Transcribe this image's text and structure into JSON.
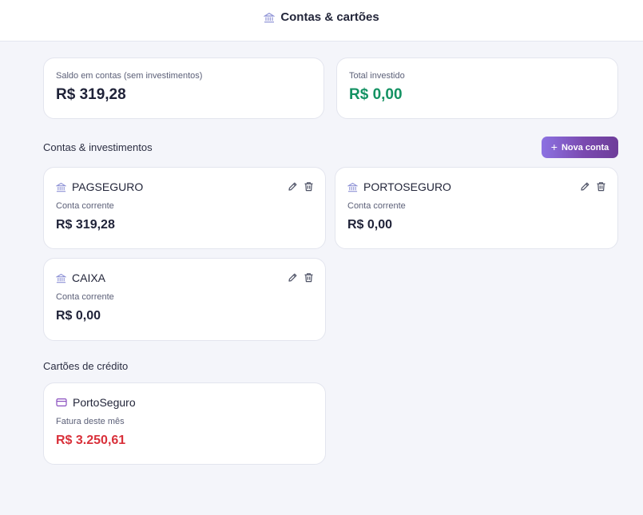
{
  "header": {
    "title": "Contas & cartões",
    "icon": "bank-icon"
  },
  "summary": {
    "balance_label": "Saldo em contas (sem investimentos)",
    "balance_value": "R$ 319,28",
    "invested_label": "Total investido",
    "invested_value": "R$ 0,00"
  },
  "accounts_section": {
    "title": "Contas & investimentos",
    "new_button": "Nova conta",
    "items": [
      {
        "name": "PAGSEGURO",
        "type": "Conta corrente",
        "amount": "R$ 319,28"
      },
      {
        "name": "PORTOSEGURO",
        "type": "Conta corrente",
        "amount": "R$ 0,00"
      },
      {
        "name": "CAIXA",
        "type": "Conta corrente",
        "amount": "R$ 0,00"
      }
    ]
  },
  "cards_section": {
    "title": "Cartões de crédito",
    "items": [
      {
        "name": "PortoSeguro",
        "label": "Fatura deste mês",
        "amount": "R$ 3.250,61"
      }
    ]
  },
  "colors": {
    "accent": "#7a4ab0",
    "positive": "#149263",
    "negative": "#d9303a",
    "bank_icon": "#8f93d6",
    "card_icon": "#8a4fbf"
  }
}
